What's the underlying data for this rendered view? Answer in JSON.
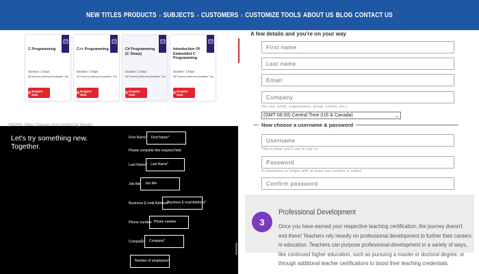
{
  "nav": {
    "items": [
      "NEW TITLES",
      "PRODUCTS",
      "SUBJECTS",
      "CUSTOMERS",
      "CUSTOMIZE TOOLS",
      "ABOUT US",
      "BLOG",
      "CONTACT US"
    ],
    "separator": "»",
    "bg": "#1e57a3"
  },
  "courses": [
    {
      "title": "C Programming",
      "duration": "Duration: 3 Days",
      "delivery": "All Delivery Methods Available: Yes",
      "button": "Enquire Now"
    },
    {
      "title": "C++ Programming",
      "duration": "Duration: 3 Days",
      "delivery": "All Delivery Methods Available: Yes",
      "button": "Enquire Now"
    },
    {
      "title": "C# Programming (C Sharp)",
      "duration": "Duration: 3 Days",
      "delivery": "All Delivery Methods Available: Yes",
      "button": "Enquire Now"
    },
    {
      "title": "Introduction Of Embedded C Programming",
      "duration": "Duration: 3 Days",
      "delivery": "All Delivery Methods Available: Yes",
      "button": "Enquire Now"
    }
  ],
  "signup": {
    "header": "A few details and you're on your way",
    "first_name": "First name",
    "last_name": "Last name",
    "email": "Email",
    "company": "Company",
    "company_hint": "(Or non- profit, organization, group, school, etc.)",
    "timezone": "(GMT-06:00) Central Time (US & Canada)",
    "section": "Now choose a username & password",
    "username": "Username",
    "username_hint": "This is what you'll use to sign in.",
    "password": "Password",
    "password_hint": "8 characters or longer with at least one number is safest.",
    "confirm": "Confirm password"
  },
  "dark_form": {
    "top_text": "(WORK. Mass Classes and Limited Dy Weeks.",
    "heading_1": "Let's try something new.",
    "heading_2": "Together.",
    "first_name_label": "First Name*",
    "first_name_ph": "First Name*",
    "error": "Please complete this required field.",
    "last_name_label": "Last Name*",
    "last_name_ph": "Last Name*",
    "job_label": "Job title",
    "job_ph": "Job title",
    "email_label": "Business E-mail Address*",
    "email_ph": "Business E-mail Address*",
    "phone_label": "Phone number",
    "phone_ph": "Phone number",
    "company_label": "Company*",
    "company_ph": "Company*",
    "employees_ph": "Number of employees*"
  },
  "prof_dev": {
    "number": "3",
    "title": "Professional Development",
    "body": "Once you have earned your respective teaching certification, the journey doesn't end there! Teachers rely heavily on professional development to further their careers in education. Teachers can purpose professional development in a variety of ways, like continued higher education, such as pursuing a master or doctoral degree, or through additional teacher certifications to boost their teaching credentials.",
    "accent": "#7a3cbd"
  }
}
